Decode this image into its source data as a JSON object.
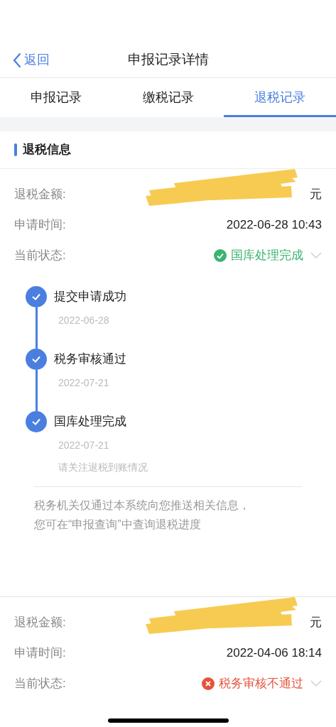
{
  "nav": {
    "back": "返回",
    "title": "申报记录详情"
  },
  "tabs": [
    {
      "label": "申报记录",
      "selected": false
    },
    {
      "label": "缴税记录",
      "selected": false
    },
    {
      "label": "退税记录",
      "selected": true
    }
  ],
  "section_title": "退税信息",
  "records": [
    {
      "amount_label": "退税金额:",
      "amount": "元",
      "time_label": "申请时间:",
      "time": "2022-06-28 10:43",
      "status_label": "当前状态:",
      "status": "国库处理完成",
      "kind": "success",
      "expanded": true,
      "steps": [
        {
          "title": "提交申请成功",
          "date": "2022-06-28",
          "done": true
        },
        {
          "title": "税务审核通过",
          "date": "2022-07-21",
          "done": true
        },
        {
          "title": "国库处理完成",
          "date": "2022-07-21",
          "note": "请关注退税到账情况",
          "done": true
        }
      ],
      "notice": [
        "税务机关仅通过本系统向您推送相关信息，",
        "您可在“申报查询”中查询退税进度"
      ]
    },
    {
      "amount_label": "退税金额:",
      "amount": "元",
      "time_label": "申请时间:",
      "time": "2022-04-06 18:14",
      "status_label": "当前状态:",
      "status": "税务审核不通过",
      "kind": "fail",
      "expanded": false
    }
  ]
}
